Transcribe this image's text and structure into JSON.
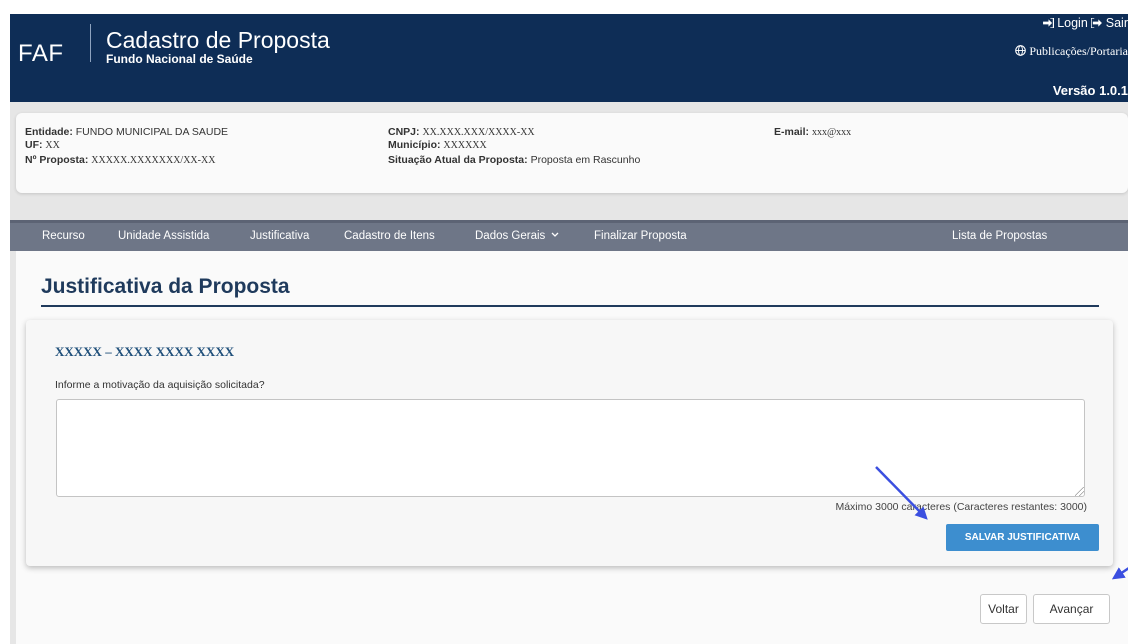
{
  "header": {
    "brand": "FAF",
    "title": "Cadastro de Proposta",
    "subtitle": "Fundo Nacional de Saúde",
    "login_icon": "sign-in-icon",
    "login_label": "Login",
    "logout_icon": "sign-out-icon",
    "logout_label": "Sair",
    "publications_icon": "globe-icon",
    "publications_label": "Publicações/Portaria",
    "version": "Versão 1.0.1"
  },
  "info": {
    "entidade_label": "Entidade:",
    "entidade_value": "FUNDO MUNICIPAL DA SAUDE",
    "uf_label": "UF:",
    "uf_value": "XX",
    "proposta_label": "Nº Proposta:",
    "proposta_value": "XXXXX.XXXXXXX/XX-XX",
    "cnpj_label": "CNPJ:",
    "cnpj_value": "XX.XXX.XXX/XXXX-XX",
    "municipio_label": "Município:",
    "municipio_value": "XXXXXX",
    "situacao_label": "Situação Atual da Proposta:",
    "situacao_value": "Proposta em Rascunho",
    "email_label": "E-mail:",
    "email_value": "xxx@xxx"
  },
  "menu": {
    "items": [
      "Recurso",
      "Unidade Assistida",
      "Justificativa",
      "Cadastro de Itens",
      "Dados Gerais",
      "Finalizar Proposta"
    ],
    "dropdown_icon": "chevron-down-icon",
    "right_item": "Lista de Propostas"
  },
  "page": {
    "title": "Justificativa da Proposta"
  },
  "form": {
    "heading": "XXXXX – XXXX XXXX XXXX",
    "question": "Informe a motivação da aquisição solicitada?",
    "textarea_value": "",
    "char_limit": "Máximo 3000 caracteres (Caracteres restantes: 3000)",
    "save_label": "SALVAR JUSTIFICATIVA"
  },
  "nav": {
    "back_label": "Voltar",
    "next_label": "Avançar"
  },
  "colors": {
    "header_bg": "#0e2d56",
    "menu_bg": "#6e7687",
    "title_color": "#1f3a5c",
    "save_button": "#3d8ecf",
    "annotation_arrow": "#3b4fe0"
  }
}
